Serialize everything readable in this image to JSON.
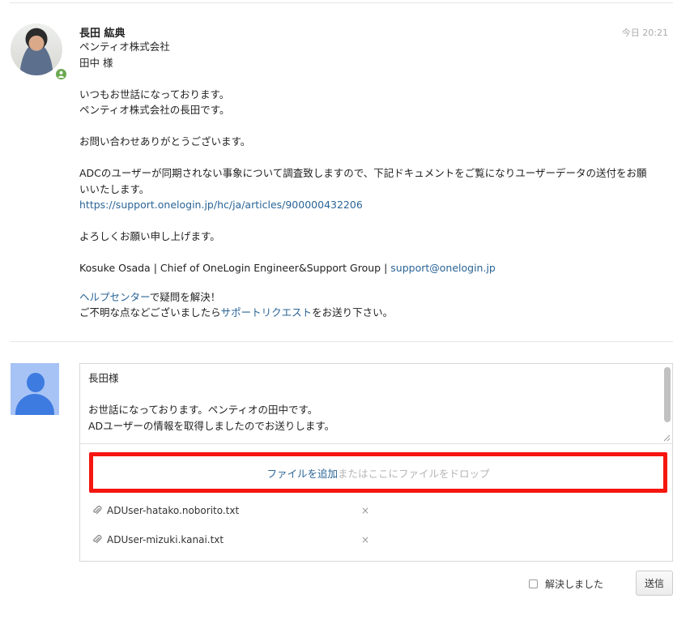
{
  "agent_message": {
    "sender": "長田 紘典",
    "timestamp": "今日 20:21",
    "lines": {
      "company": "ペンティオ株式会社",
      "addressee": "田中 様",
      "greeting1": "いつもお世話になっております。",
      "greeting2": "ペンティオ株式会社の長田です。",
      "thanks": "お問い合わせありがとうございます。",
      "body1": "ADCのユーザーが同期されない事象について調査致しますので、下記ドキュメントをご覧になりユーザーデータの送付をお願",
      "body2": "いいたします。",
      "article_link": "https://support.onelogin.jp/hc/ja/articles/900000432206",
      "closing": "よろしくお願い申し上げます。",
      "signature": "Kosuke Osada | Chief of OneLogin Engineer&Support Group | ",
      "signature_email": "support@onelogin.jp",
      "help_center_link": "ヘルプセンター",
      "help_center_suffix": "で疑問を解決！",
      "request_prefix": "ご不明な点などございましたら",
      "request_link": "サポートリクエスト",
      "request_suffix": "をお送り下さい。"
    }
  },
  "reply": {
    "text": "長田様\n\nお世話になっております。ペンティオの田中です。\nADユーザーの情報を取得しましたのでお送りします。",
    "dropzone_link": "ファイルを追加",
    "dropzone_hint": "またはここにファイルをドロップ",
    "attachments": [
      {
        "name": "ADUser-hatako.noborito.txt",
        "remove": "×"
      },
      {
        "name": "ADUser-mizuki.kanai.txt",
        "remove": "×"
      }
    ],
    "resolved_label": "解決しました",
    "send_label": "送信"
  },
  "icons": {
    "paperclip": "paperclip-icon",
    "agent_badge": "person-icon",
    "remove": "close-icon"
  },
  "colors": {
    "link": "#2a6496",
    "highlight": "#f5160f",
    "badge": "#6aa84f",
    "user_avatar": "#a7c3f5"
  }
}
